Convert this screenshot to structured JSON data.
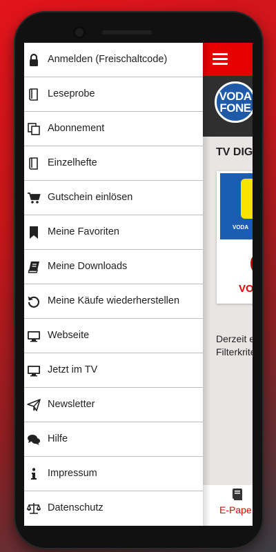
{
  "drawer": {
    "items": [
      {
        "label": "Anmelden (Freischaltcode)",
        "icon": "lock-icon"
      },
      {
        "label": "Leseprobe",
        "icon": "book-outline-icon"
      },
      {
        "label": "Abonnement",
        "icon": "copy-icon"
      },
      {
        "label": "Einzelhefte",
        "icon": "book-outline-icon"
      },
      {
        "label": "Gutschein einlösen",
        "icon": "cart-icon"
      },
      {
        "label": "Meine Favoriten",
        "icon": "bookmark-icon"
      },
      {
        "label": "Meine Downloads",
        "icon": "book-icon"
      },
      {
        "label": "Meine Käufe wiederherstellen",
        "icon": "restore-icon"
      },
      {
        "label": "Webseite",
        "icon": "desktop-icon"
      },
      {
        "label": "Jetzt im TV",
        "icon": "desktop-icon"
      },
      {
        "label": "Newsletter",
        "icon": "paper-plane-icon"
      },
      {
        "label": "Hilfe",
        "icon": "comments-icon"
      },
      {
        "label": "Impressum",
        "icon": "info-icon"
      },
      {
        "label": "Datenschutz",
        "icon": "balance-scale-icon"
      }
    ]
  },
  "app": {
    "logo_line1": "VODA",
    "logo_line2": "FONE",
    "section_title": "TV DIG",
    "cover_small": "VODA",
    "cover_red": "VO",
    "info_line1": "Derzeit e",
    "info_line2": "Filterkrite",
    "bottom_tab_label": "E-Pape"
  },
  "colors": {
    "accent": "#e60000",
    "header_dark": "#2f2f2f",
    "logo_blue": "#1e5aa8"
  }
}
